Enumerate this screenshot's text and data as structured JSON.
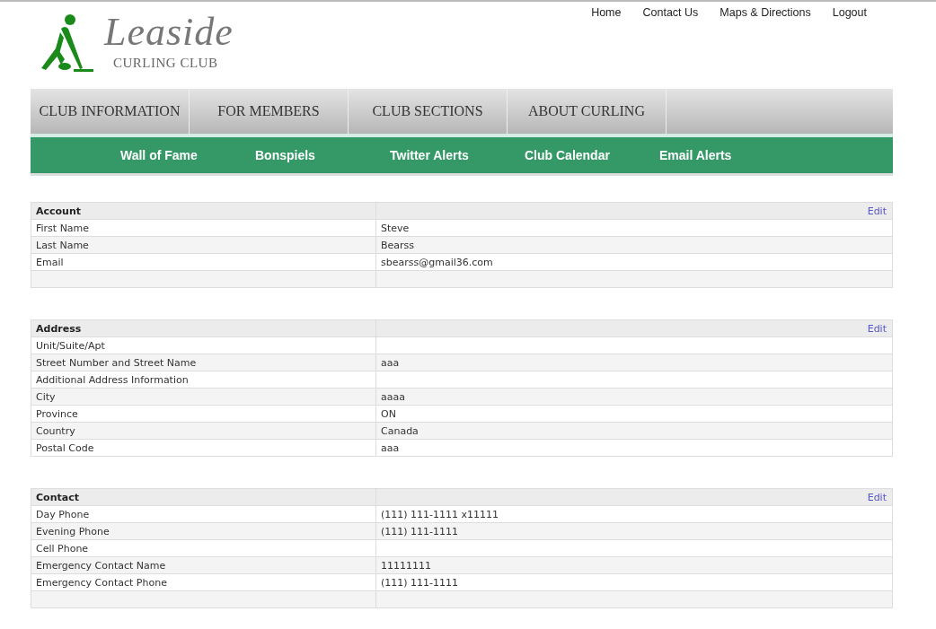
{
  "logo": {
    "name": "Leaside",
    "subtitle": "CURLING CLUB"
  },
  "top_links": [
    "Home",
    "Contact Us",
    "Maps & Directions",
    "Logout"
  ],
  "main_nav": [
    "CLUB INFORMATION",
    "FOR MEMBERS",
    "CLUB SECTIONS",
    "ABOUT CURLING"
  ],
  "sub_nav": [
    "Wall of Fame",
    "Bonspiels",
    "Twitter Alerts",
    "Club Calendar",
    "Email Alerts"
  ],
  "sections": [
    {
      "title": "Account",
      "action": "Edit",
      "trailing_blank_row": true,
      "rows": [
        {
          "label": "First Name",
          "value": "Steve"
        },
        {
          "label": "Last Name",
          "value": "Bearss"
        },
        {
          "label": "Email",
          "value": "sbearss@gmail36.com"
        }
      ]
    },
    {
      "title": "Address",
      "action": "Edit",
      "trailing_blank_row": false,
      "rows": [
        {
          "label": "Unit/Suite/Apt"
        },
        {
          "label": "Street Number and Street Name",
          "value": "aaa"
        },
        {
          "label": "Additional Address Information"
        },
        {
          "label": "City",
          "value": "aaaa"
        },
        {
          "label": "Province",
          "value": "ON"
        },
        {
          "label": "Country",
          "value": "Canada"
        },
        {
          "label": "Postal Code",
          "value": "aaa"
        }
      ]
    },
    {
      "title": "Contact",
      "action": "Edit",
      "trailing_blank_row": true,
      "rows": [
        {
          "label": "Day Phone",
          "value": "(111) 111-1111 x11111"
        },
        {
          "label": "Evening Phone",
          "value": "(111) 111-1111"
        },
        {
          "label": "Cell Phone"
        },
        {
          "label": "Emergency Contact Name",
          "value": "11111111"
        },
        {
          "label": "Emergency Contact Phone",
          "value": "(111) 111-1111"
        }
      ]
    }
  ]
}
